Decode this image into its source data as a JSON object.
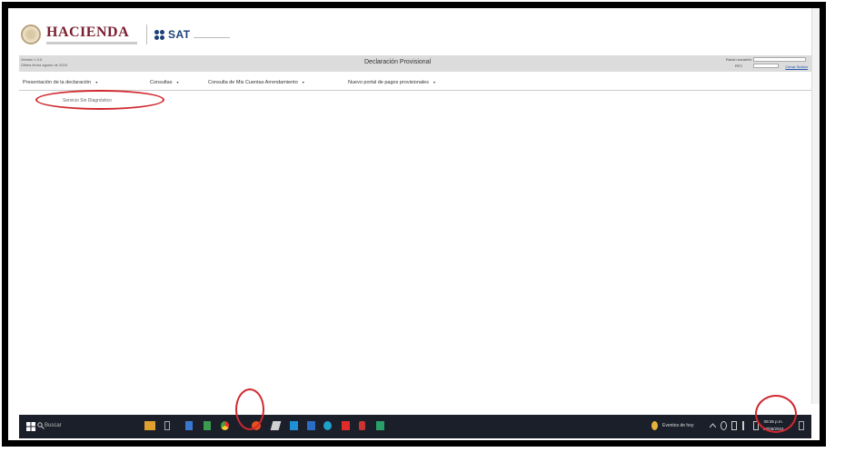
{
  "header": {
    "hacienda_text": "HACIENDA",
    "sat_text": "SAT",
    "version_line1": "Versión 1.0.6",
    "version_line2": "Última fecha agosto de 2024",
    "page_title": "Declaración Provisional",
    "rfc_label": "Razón social/rfc",
    "rfc_label2": "RFC",
    "close_session": "Cerrar Sesión"
  },
  "menu": {
    "items": [
      {
        "label": "Presentación de la declaración"
      },
      {
        "label": "Consultas"
      },
      {
        "label": "Consulta de Mis Cuentas Arrendamiento"
      },
      {
        "label": "Nuevo portal de pagos provisionales"
      }
    ],
    "caret": "▾",
    "submenu_item": "Servicio Sin Diagnóstico"
  },
  "taskbar": {
    "search_label": "Buscar",
    "weather_text": "Eventos de hoy",
    "time": "09:35 p.m.",
    "date": "08/08/2024"
  },
  "colors": {
    "annotation": "#d0282e",
    "taskbar": "#1b1f2a",
    "hacienda": "#7a1e2f",
    "sat": "#1c3f7a"
  }
}
